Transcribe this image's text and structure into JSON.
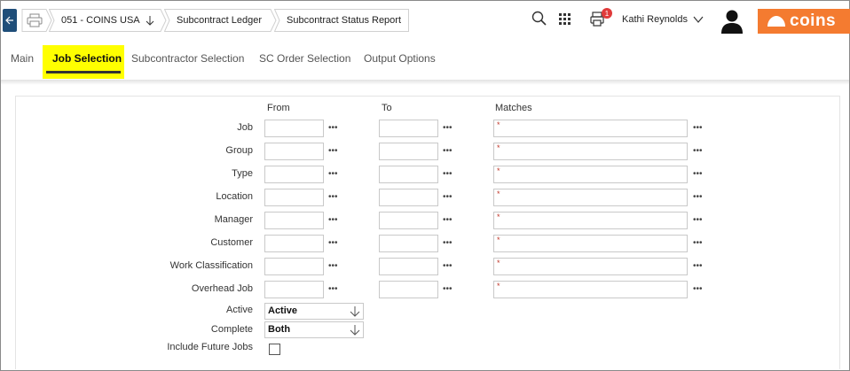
{
  "header": {
    "company": "051 - COINS USA",
    "breadcrumbs": [
      "Subcontract Ledger",
      "Subcontract Status Report"
    ],
    "notification_count": "1",
    "user_name": "Kathi Reynolds",
    "logo_text": "coins",
    "icons": [
      "back-arrow-icon",
      "print-icon",
      "sort-down-icon",
      "search-icon",
      "apps-grid-icon",
      "printer-queue-icon",
      "chevron-down-icon",
      "user-avatar-icon",
      "coins-logo"
    ]
  },
  "tabs": [
    "Main",
    "Job Selection",
    "Subcontractor Selection",
    "SC Order Selection",
    "Output Options"
  ],
  "active_tab": "Job Selection",
  "form": {
    "columns": {
      "from": "From",
      "to": "To",
      "matches": "Matches"
    },
    "lookup_glyph": "•••",
    "rows": [
      {
        "label": "Job",
        "from": "",
        "to": "",
        "matches": "*"
      },
      {
        "label": "Group",
        "from": "",
        "to": "",
        "matches": "*"
      },
      {
        "label": "Type",
        "from": "",
        "to": "",
        "matches": "*"
      },
      {
        "label": "Location",
        "from": "",
        "to": "",
        "matches": "*"
      },
      {
        "label": "Manager",
        "from": "",
        "to": "",
        "matches": "*"
      },
      {
        "label": "Customer",
        "from": "",
        "to": "",
        "matches": "*"
      },
      {
        "label": "Work Classification",
        "from": "",
        "to": "",
        "matches": "*"
      },
      {
        "label": "Overhead Job",
        "from": "",
        "to": "",
        "matches": "*"
      }
    ],
    "active": {
      "label": "Active",
      "value": "Active"
    },
    "complete": {
      "label": "Complete",
      "value": "Both"
    },
    "include_future": {
      "label": "Include Future Jobs",
      "checked": false
    }
  },
  "colors": {
    "accent_tab_highlight": "#ffff00",
    "back_button": "#1f4e79",
    "logo_bg": "#f47b30",
    "badge": "#e03a3a"
  }
}
